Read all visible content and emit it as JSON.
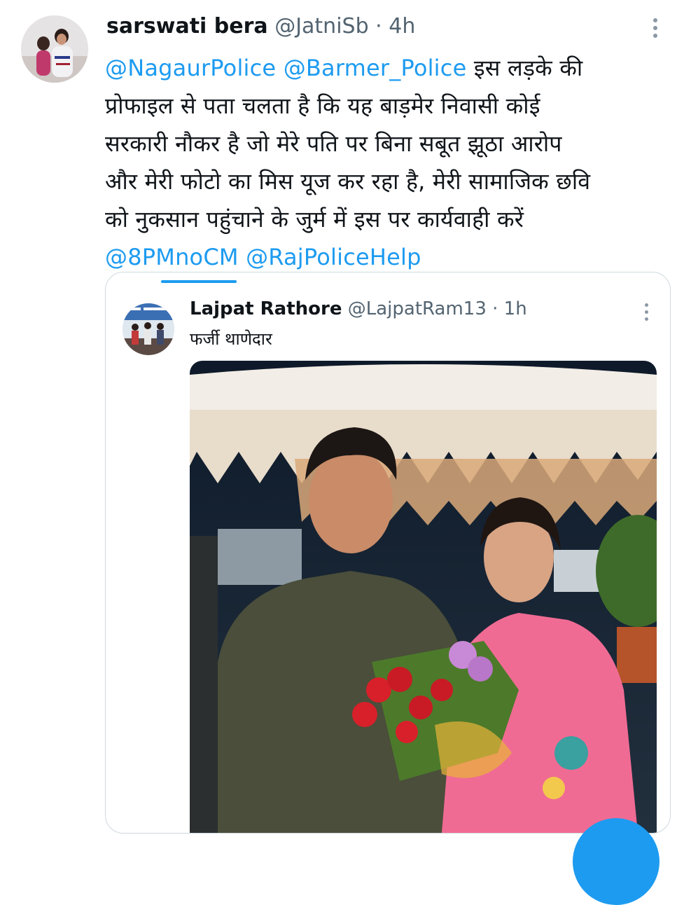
{
  "tweet": {
    "author_name": "sarswati bera",
    "author_handle": "@JatniSb",
    "separator": "·",
    "time": "4h",
    "mention_1": "@NagaurPolice",
    "mention_2": "@Barmer_Police",
    "line_1_rest": "इस लड़के की",
    "line_2": "प्रोफाइल से पता चलता है कि यह बाड़मेर निवासी कोई",
    "line_3": "सरकारी नौकर है जो मेरे पति पर बिना सबूत झूठा आरोप",
    "line_4": "और मेरी फोटो का मिस यूज कर रहा है, मेरी सामाजिक छवि",
    "line_5": "को नुकसान पहुंचाने के जुर्म में इस पर कार्यवाही करें",
    "mention_3": "@8PMnoCM",
    "mention_4": "@RajPoliceHelp"
  },
  "quoted": {
    "author_name": "Lajpat Rathore",
    "author_handle": "@LajpatRam13",
    "separator": "·",
    "time": "1h",
    "text": "फर्जी थाणेदार"
  },
  "icons": {
    "tweet_more": "more-vertical-icon",
    "quote_more": "more-vertical-icon",
    "compose": "compose-fab"
  },
  "colors": {
    "link": "#1d9bf0",
    "text": "#0f1419",
    "secondary": "#536471",
    "border": "#cfd9de"
  }
}
